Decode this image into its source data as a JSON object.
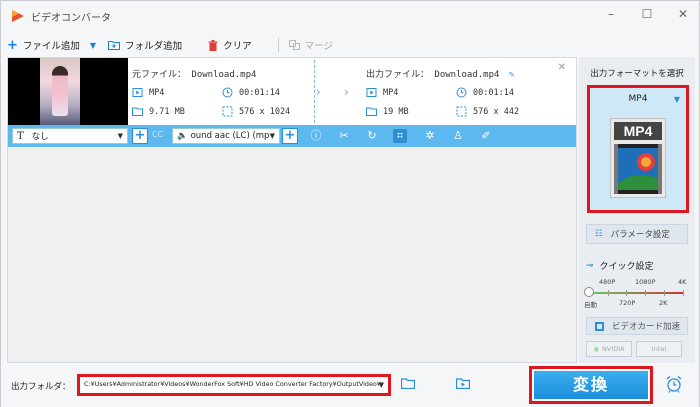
{
  "window": {
    "title": "ビデオコンバータ",
    "controls": [
      "–",
      "☐",
      "✕"
    ]
  },
  "toolbar": {
    "add_file": "ファイル追加",
    "add_folder": "フォルダ追加",
    "clear": "クリア",
    "merge": "マージ"
  },
  "file": {
    "source_title": "元ファイル： Download.mp4",
    "output_title": "出力ファイル： Download.mp4",
    "source": {
      "format": "MP4",
      "duration": "00:01:14",
      "size": "9.71 MB",
      "resolution": "576 x 1024"
    },
    "output": {
      "format": "MP4",
      "duration": "00:01:14",
      "size": "19 MB",
      "resolution": "576 x 442"
    }
  },
  "edit": {
    "subtitle": "なし",
    "cc": "CC",
    "audio": "ound aac (LC) (mp"
  },
  "right_panel": {
    "title": "出力フォーマットを選択",
    "format": "MP4",
    "format_icon_text": "MP4",
    "param_settings": "パラメータ設定",
    "quick_settings": "クイック設定",
    "quality_top": [
      "480P",
      "1080P",
      "4K"
    ],
    "quality_bottom": [
      "自動",
      "720P",
      "2K"
    ],
    "gpu_accel": "ビデオカード加速",
    "nvidia": "NVIDIA",
    "intel": "Intel"
  },
  "bottom": {
    "output_folder_label": "出力フォルダ：",
    "output_path": "C:¥Users¥Administrator¥Videos¥WonderFox Soft¥HD Video Converter Factory¥OutputVideo¥",
    "convert": "変換"
  }
}
